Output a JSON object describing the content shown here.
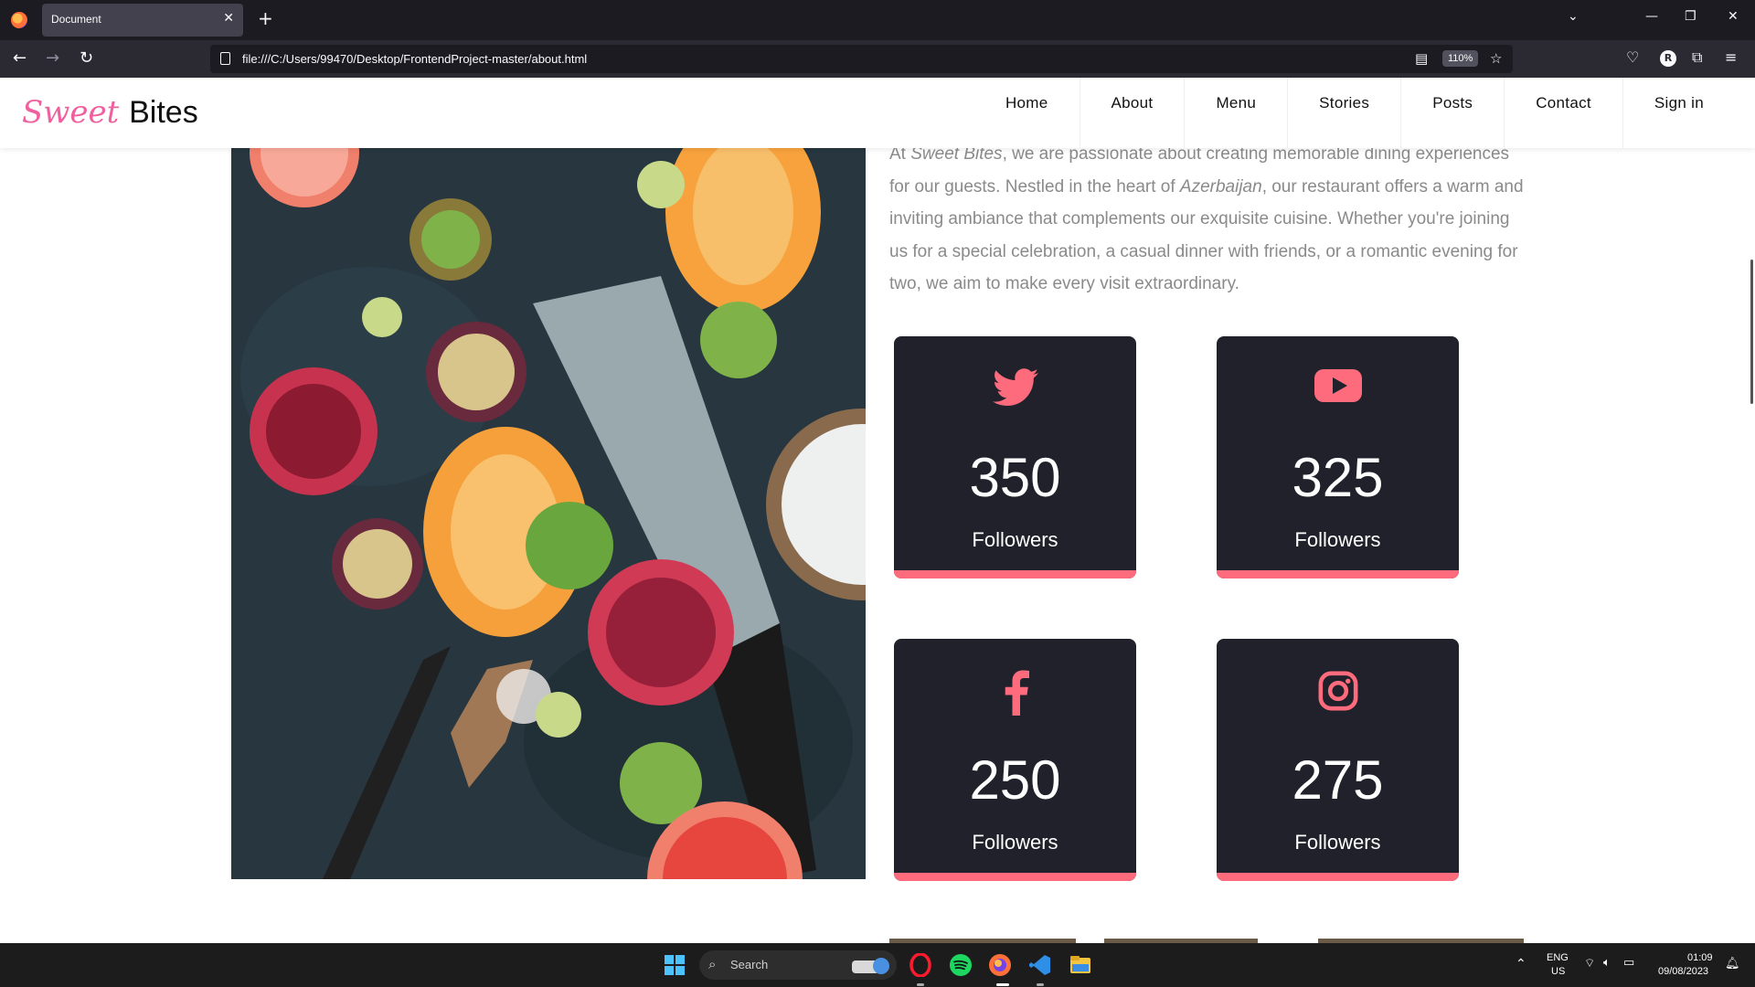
{
  "browser": {
    "tab_title": "Document",
    "tab_close": "✕",
    "new_tab": "+",
    "url": "file:///C:/Users/99470/Desktop/FrontendProject-master/about.html",
    "zoom": "110%",
    "profile_initial": "R"
  },
  "site": {
    "logo_sweet": "Sweet",
    "logo_bites": "Bites",
    "nav": [
      "Home",
      "About",
      "Menu",
      "Stories",
      "Posts",
      "Contact",
      "Sign in"
    ]
  },
  "intro": {
    "p1": "At ",
    "brand": "Sweet Bites",
    "p2": ", we are passionate about creating memorable dining experiences for our guests. Nestled in the heart of ",
    "place": "Azerbaijan",
    "p3": ", our restaurant offers a warm and inviting ambiance that complements our exquisite cuisine. Whether you're joining us for a special celebration, a casual dinner with friends, or a romantic evening for two, we aim to make every visit extraordinary."
  },
  "stats": [
    {
      "icon": "twitter-icon",
      "count": "350",
      "label": "Followers"
    },
    {
      "icon": "youtube-icon",
      "count": "325",
      "label": "Followers"
    },
    {
      "icon": "facebook-icon",
      "count": "250",
      "label": "Followers"
    },
    {
      "icon": "instagram-icon",
      "count": "275",
      "label": "Followers"
    }
  ],
  "colors": {
    "accent": "#fd6b7d",
    "card_bg": "#20212a",
    "logo_pink": "#f0609e"
  },
  "taskbar": {
    "search": "Search",
    "lang1": "ENG",
    "lang2": "US",
    "time": "01:09",
    "date": "09/08/2023"
  }
}
